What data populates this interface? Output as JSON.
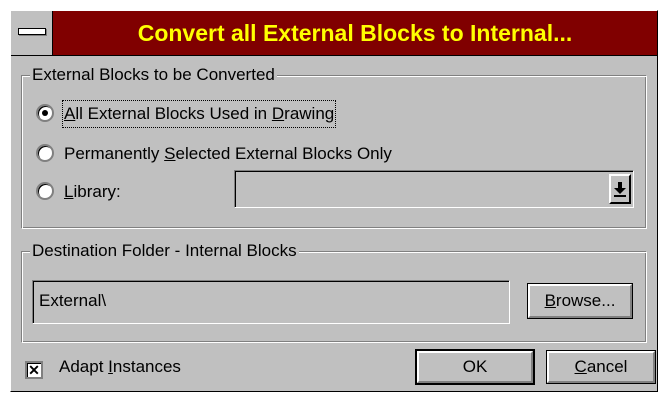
{
  "window": {
    "title": "Convert all External Blocks to Internal..."
  },
  "source_group": {
    "legend": "External Blocks to be Converted",
    "options": [
      {
        "pre": "",
        "key": "A",
        "post": "ll External Blocks Used in ",
        "key2": "D",
        "post2": "rawing",
        "checked": true
      },
      {
        "pre": "Permanently ",
        "key": "S",
        "post": "elected External Blocks Only",
        "checked": false
      },
      {
        "pre": "",
        "key": "L",
        "post": "ibrary:",
        "checked": false
      }
    ],
    "library_value": "",
    "dropdown_icon": "arrow-down-to-bar-icon"
  },
  "destination_group": {
    "legend": "Destination Folder - Internal Blocks",
    "folder_value": "External\\",
    "browse_pre": "",
    "browse_key": "B",
    "browse_post": "rowse..."
  },
  "adapt_instances": {
    "pre": "Adapt ",
    "key": "I",
    "post": "nstances",
    "checked": true
  },
  "buttons": {
    "ok": "OK",
    "cancel_key": "C",
    "cancel_post": "ancel"
  },
  "colors": {
    "titlebar_bg": "#800000",
    "title_text": "#ffff00",
    "face": "#c0c0c0"
  }
}
